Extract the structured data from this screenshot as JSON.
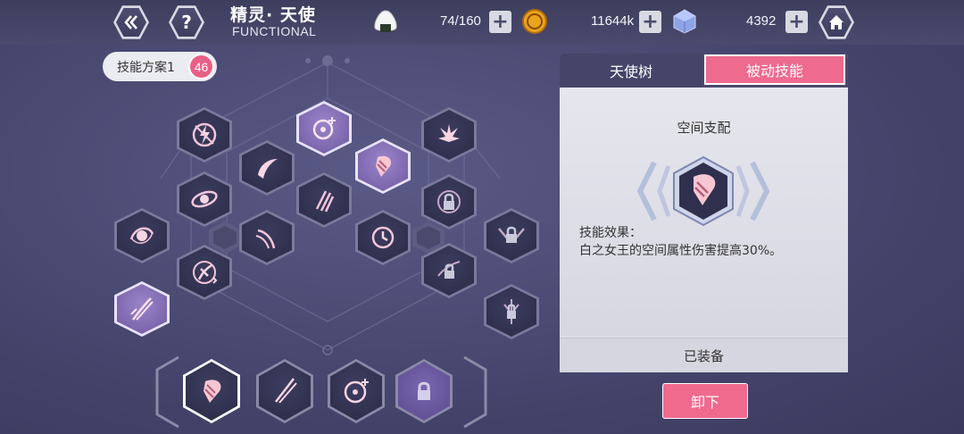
{
  "header": {
    "back_icon": "double-chevron-left-icon",
    "help_label": "?",
    "title_cn": "精灵· 天使",
    "title_en": "FUNCTIONAL",
    "home_icon": "home-icon",
    "resources": [
      {
        "icon": "rice-ball-icon",
        "value": "74/160",
        "plus": "+"
      },
      {
        "icon": "gold-coin-icon",
        "value": "11644k",
        "plus": "+"
      },
      {
        "icon": "crystal-cube-icon",
        "value": "4392",
        "plus": "+"
      }
    ]
  },
  "plan": {
    "label": "技能方案1",
    "points": "46"
  },
  "tabs": {
    "tree": "天使树",
    "passive": "被动技能"
  },
  "detail": {
    "name": "空间支配",
    "effect_label": "技能效果：",
    "effect_text": "白之女王的空间属性伤害提高30%。",
    "status": "已装备",
    "action": "卸下"
  },
  "colors": {
    "accent": "#ee6a8e",
    "panel": "#dcdce6",
    "background": "#4a4a6e"
  }
}
